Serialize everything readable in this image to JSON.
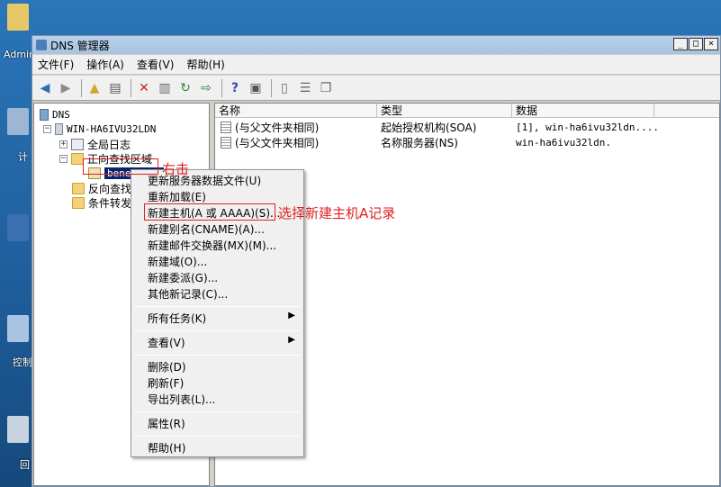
{
  "desktop": {
    "icon_labels": [
      "Admin",
      "计",
      "控制",
      "回"
    ]
  },
  "window": {
    "title": "DNS 管理器",
    "min": "_",
    "max": "□",
    "close": "×"
  },
  "menu": [
    "文件(F)",
    "操作(A)",
    "查看(V)",
    "帮助(H)"
  ],
  "tree": {
    "root": "DNS",
    "server": "WIN-HA6IVU32LDN",
    "global_log": "全局日志",
    "forward_zones": "正向查找区域",
    "zone": "benet.com",
    "reverse_zones": "反向查找",
    "conditional": "条件转发"
  },
  "list": {
    "columns": [
      "名称",
      "类型",
      "数据"
    ],
    "rows": [
      {
        "name": "(与父文件夹相同)",
        "type": "起始授权机构(SOA)",
        "data": "[1], win-ha6ivu32ldn...."
      },
      {
        "name": "(与父文件夹相同)",
        "type": "名称服务器(NS)",
        "data": "win-ha6ivu32ldn."
      }
    ]
  },
  "context_menu": {
    "update": "更新服务器数据文件(U)",
    "reload": "重新加载(E)",
    "new_host": "新建主机(A 或 AAAA)(S)...",
    "new_alias": "新建别名(CNAME)(A)...",
    "new_mx": "新建邮件交换器(MX)(M)...",
    "new_domain": "新建域(O)...",
    "new_delegation": "新建委派(G)...",
    "other_records": "其他新记录(C)...",
    "all_tasks": "所有任务(K)",
    "view": "查看(V)",
    "delete": "删除(D)",
    "refresh": "刷新(F)",
    "export": "导出列表(L)...",
    "properties": "属性(R)",
    "help": "帮助(H)"
  },
  "annotations": {
    "right_click": "右击",
    "select_new_host": "选择新建主机A记录"
  },
  "colors": {
    "annotation": "#e02020",
    "selection": "#0a246a"
  }
}
